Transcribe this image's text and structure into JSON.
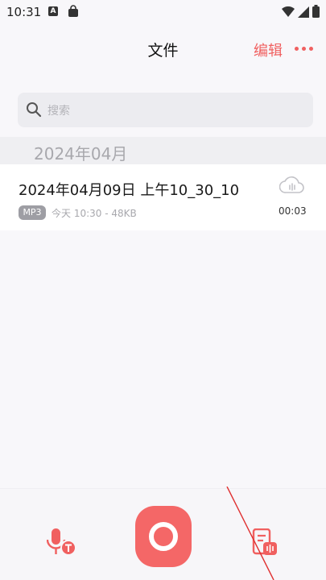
{
  "status_bar": {
    "time": "10:31",
    "notif_letter": "A"
  },
  "header": {
    "title": "文件",
    "edit_label": "编辑"
  },
  "search": {
    "placeholder": "搜索"
  },
  "list": {
    "month": "2024年04月",
    "files": [
      {
        "name": "2024年04月09日 上午10_30_10",
        "format": "MP3",
        "meta": "今天 10:30 - 48KB",
        "duration": "00:03"
      }
    ]
  },
  "colors": {
    "accent": "#f06060",
    "record": "#f46767"
  },
  "icons": [
    "search-icon",
    "more-icon",
    "cloud-icon",
    "voice-to-text-icon",
    "record-icon",
    "transcript-icon"
  ]
}
